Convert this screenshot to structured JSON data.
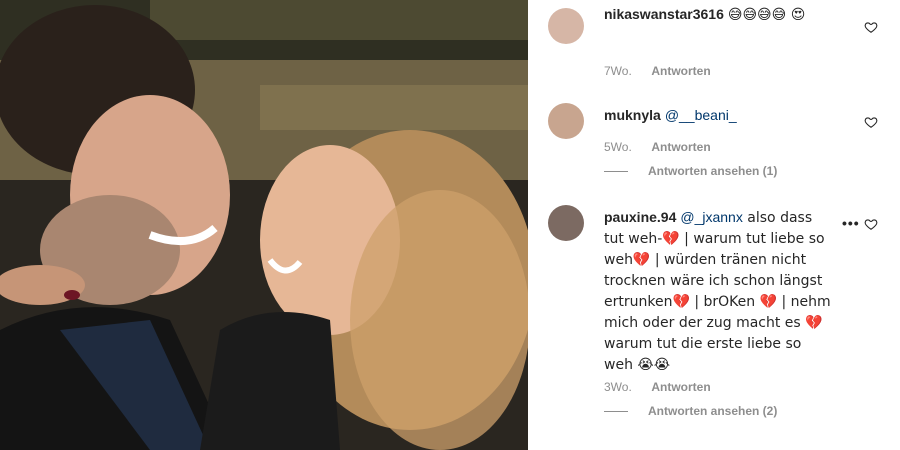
{
  "comments": [
    {
      "user": "nikaswanstar3616",
      "text": "😅😅😅😅 😍",
      "age": "7Wo.",
      "reply": "Antworten"
    },
    {
      "user": "muknyla",
      "mention": "@__beani_",
      "text": "",
      "age": "5Wo.",
      "reply": "Antworten",
      "view_replies": "Antworten ansehen (1)"
    },
    {
      "user": "pauxine.94",
      "mention": "@_jxannx",
      "text": " also dass tut weh-💔 | warum tut liebe so weh💔 | würden tränen nicht trocknen wäre ich schon längst ertrunken💔 | brOKen 💔 | nehm mich oder der zug macht es 💔 warum tut die erste liebe so weh 😭😭",
      "age": "3Wo.",
      "reply": "Antworten",
      "view_replies": "Antworten ansehen (2)",
      "more": "•••"
    }
  ],
  "icons": {
    "like": "heart-outline-icon",
    "more": "more-options-icon"
  },
  "colors": {
    "text": "#262626",
    "secondary": "#8e8e8e",
    "mention": "#00376b"
  }
}
